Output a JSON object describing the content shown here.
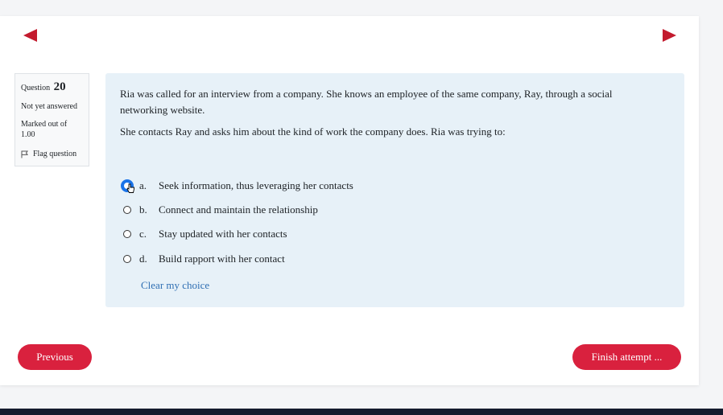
{
  "question_info": {
    "label": "Question",
    "number": "20",
    "status": "Not yet answered",
    "marked_out_of": "Marked out of",
    "score": "1.00",
    "flag_label": "Flag question"
  },
  "question": {
    "paragraph1": "Ria was called for an interview from a company. She knows an employee of the same company, Ray, through a social networking website.",
    "paragraph2": "She contacts Ray and asks him about the kind of work the company does. Ria was trying to:"
  },
  "answers": [
    {
      "letter": "a.",
      "text": "Seek information, thus leveraging her contacts",
      "focused": true
    },
    {
      "letter": "b.",
      "text": "Connect and maintain the relationship",
      "focused": false
    },
    {
      "letter": "c.",
      "text": "Stay updated with her contacts",
      "focused": false
    },
    {
      "letter": "d.",
      "text": "Build rapport with her contact",
      "focused": false
    }
  ],
  "clear_choice": "Clear my choice",
  "buttons": {
    "previous": "Previous",
    "finish": "Finish attempt ..."
  },
  "colors": {
    "accent": "#d9213e",
    "arrow": "#c31b2e",
    "content_bg": "#e7f1f8",
    "link": "#2f6fb3"
  },
  "icons": {
    "prev_page": "triangle-left-icon",
    "next_page": "triangle-right-icon",
    "flag": "flag-icon",
    "cursor": "hand-cursor-icon"
  }
}
